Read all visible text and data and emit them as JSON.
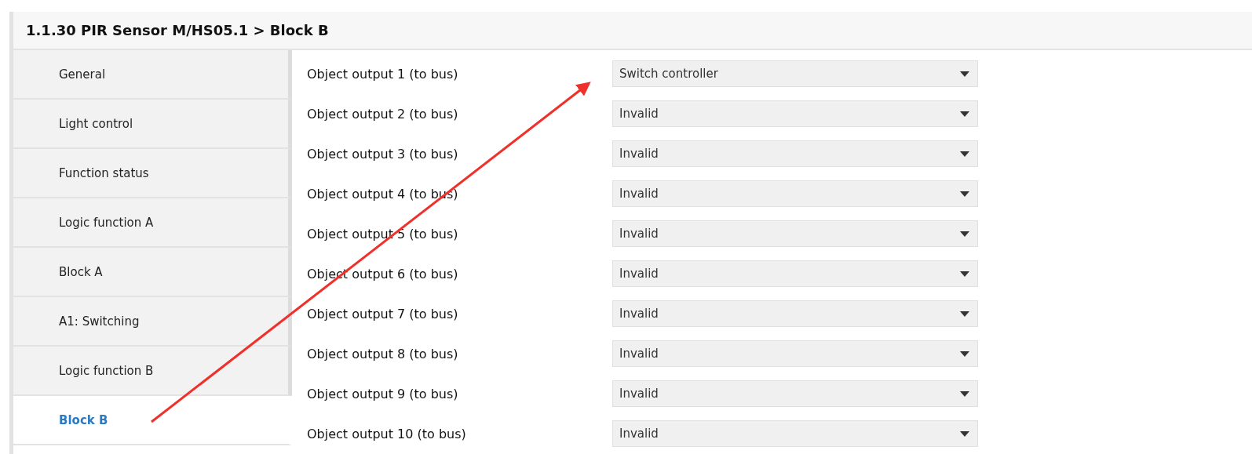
{
  "header": {
    "title": "1.1.30 PIR Sensor M/HS05.1 > Block B"
  },
  "sidebar": {
    "items": [
      {
        "label": "General",
        "selected": false
      },
      {
        "label": "Light control",
        "selected": false
      },
      {
        "label": "Function status",
        "selected": false
      },
      {
        "label": "Logic function A",
        "selected": false
      },
      {
        "label": "Block A",
        "selected": false
      },
      {
        "label": "A1: Switching",
        "selected": false
      },
      {
        "label": "Logic function B",
        "selected": false
      },
      {
        "label": "Block B",
        "selected": true
      }
    ]
  },
  "parameters": [
    {
      "label": "Object output 1 (to bus)",
      "value": "Switch controller"
    },
    {
      "label": "Object output 2 (to bus)",
      "value": "Invalid"
    },
    {
      "label": "Object output 3 (to bus)",
      "value": "Invalid"
    },
    {
      "label": "Object output 4 (to bus)",
      "value": "Invalid"
    },
    {
      "label": "Object output 5 (to bus)",
      "value": "Invalid"
    },
    {
      "label": "Object output 6 (to bus)",
      "value": "Invalid"
    },
    {
      "label": "Object output 7 (to bus)",
      "value": "Invalid"
    },
    {
      "label": "Object output 8 (to bus)",
      "value": "Invalid"
    },
    {
      "label": "Object output 9 (to bus)",
      "value": "Invalid"
    },
    {
      "label": "Object output 10 (to bus)",
      "value": "Invalid"
    }
  ]
}
